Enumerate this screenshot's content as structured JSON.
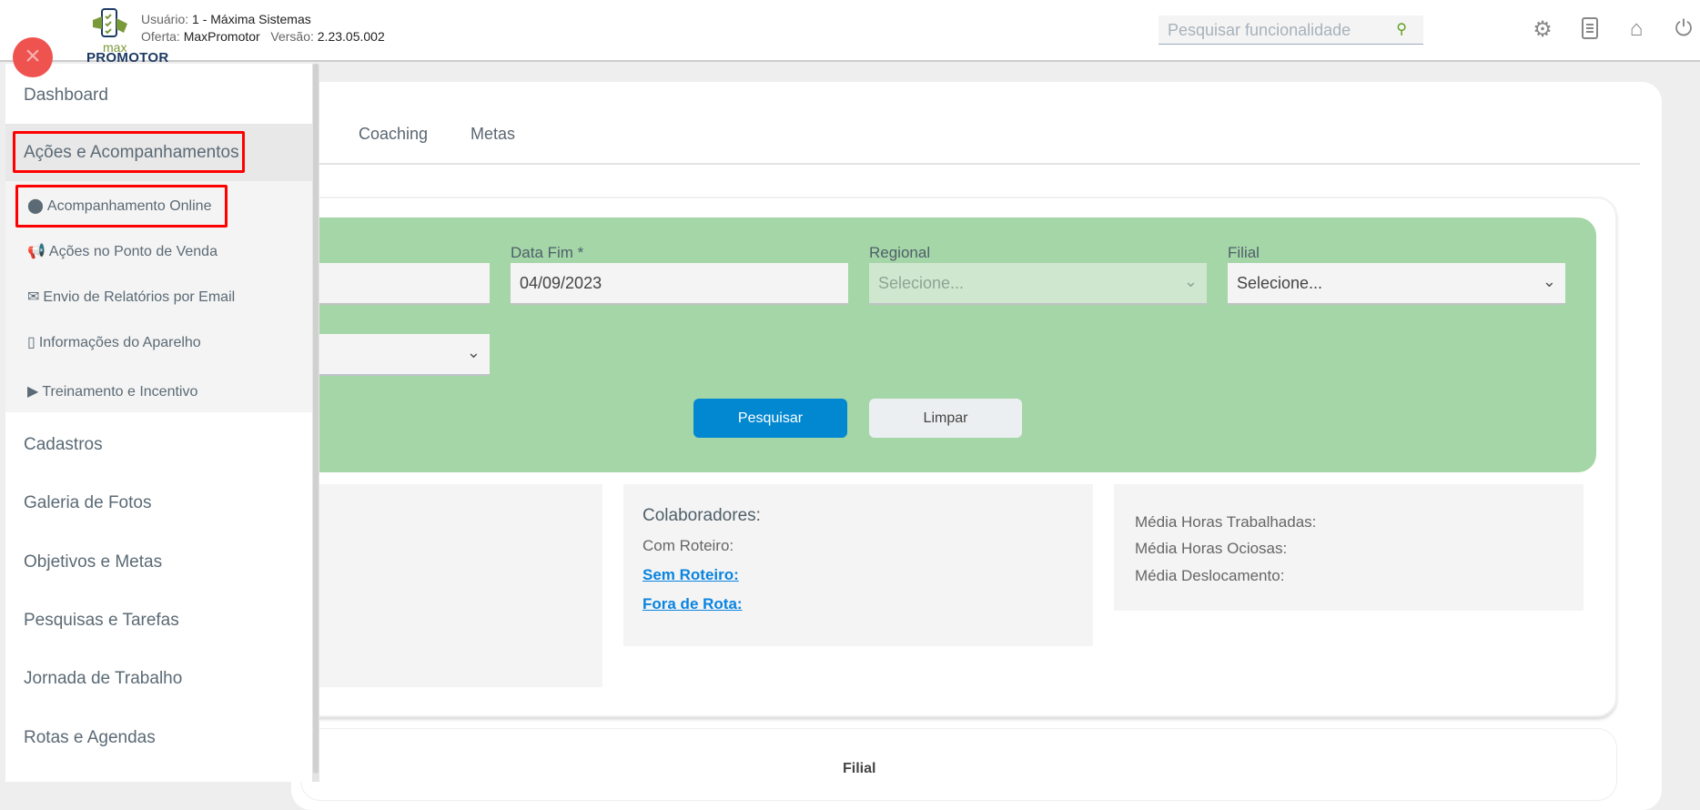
{
  "header": {
    "logo": {
      "small": "max",
      "big": "PROMOTOR"
    },
    "user_label": "Usuário:",
    "user_value": "1 - Máxima Sistemas",
    "offer_label": "Oferta:",
    "offer_value": "MaxPromotor",
    "version_label": "Versão:",
    "version_value": "2.23.05.002",
    "search_placeholder": "Pesquisar funcionalidade",
    "icons": [
      "gears-icon",
      "document-icon",
      "home-icon",
      "power-icon"
    ]
  },
  "sidebar": {
    "items": [
      {
        "label": "Dashboard"
      },
      {
        "label": "Ações e Acompanhamentos",
        "expanded": true,
        "highlighted": true
      },
      {
        "label": "Cadastros"
      },
      {
        "label": "Galeria de Fotos"
      },
      {
        "label": "Objetivos e Metas"
      },
      {
        "label": "Pesquisas e Tarefas"
      },
      {
        "label": "Jornada de Trabalho"
      },
      {
        "label": "Rotas e Agendas"
      }
    ],
    "subitems": [
      {
        "label": "Acompanhamento Online",
        "icon": "map-marker-icon",
        "highlighted": true
      },
      {
        "label": "Ações no Ponto de Venda",
        "icon": "bullhorn-icon"
      },
      {
        "label": "Envio de Relatórios por Email",
        "icon": "envelope-icon"
      },
      {
        "label": "Informações do Aparelho",
        "icon": "mobile-icon"
      },
      {
        "label": "Treinamento e Incentivo",
        "icon": "tv-play-icon"
      }
    ]
  },
  "tabs": [
    {
      "label": "Coaching"
    },
    {
      "label": "Metas"
    }
  ],
  "filters": {
    "data_fim_label": "Data Fim *",
    "data_fim_value": "04/09/2023",
    "regional_label": "Regional",
    "regional_value": "Selecione...",
    "filial_label": "Filial",
    "filial_value": "Selecione...",
    "search_button": "Pesquisar",
    "clear_button": "Limpar"
  },
  "stats": {
    "colaboradores": "Colaboradores:",
    "com_roteiro": "Com Roteiro:",
    "sem_roteiro": "Sem Roteiro:",
    "fora_de_rota": "Fora de Rota:",
    "media_trabalhadas": "Média Horas Trabalhadas:",
    "media_ociosas": "Média Horas Ociosas:",
    "media_deslocamento": "Média Deslocamento:"
  },
  "table": {
    "header_filial": "Filial"
  }
}
